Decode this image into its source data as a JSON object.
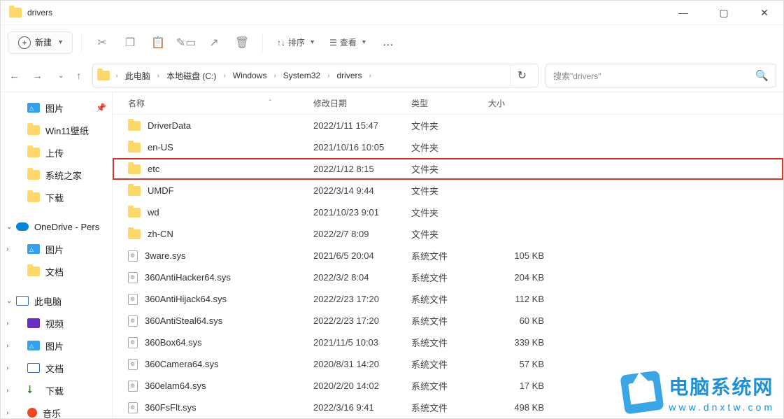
{
  "title": "drivers",
  "toolbar": {
    "new_label": "新建",
    "sort_label": "排序",
    "view_label": "查看"
  },
  "breadcrumb": [
    "此电脑",
    "本地磁盘 (C:)",
    "Windows",
    "System32",
    "drivers"
  ],
  "search": {
    "placeholder": "搜索\"drivers\""
  },
  "columns": {
    "name": "名称",
    "modified": "修改日期",
    "type": "类型",
    "size": "大小"
  },
  "sidebar": [
    {
      "label": "图片",
      "icon": "ico-pic",
      "pin": true,
      "indent": 1
    },
    {
      "label": "Win11壁纸",
      "icon": "ico-folder",
      "indent": 1
    },
    {
      "label": "上传",
      "icon": "ico-folder",
      "indent": 1
    },
    {
      "label": "系统之家",
      "icon": "ico-folder",
      "indent": 1
    },
    {
      "label": "下载",
      "icon": "ico-folder",
      "indent": 1
    },
    {
      "label": "OneDrive - Pers",
      "icon": "ico-onedrive",
      "expander": "⌄",
      "indent": 0,
      "gap": true
    },
    {
      "label": "图片",
      "icon": "ico-pic",
      "expander": "›",
      "indent": 1
    },
    {
      "label": "文档",
      "icon": "ico-folder",
      "indent": 1
    },
    {
      "label": "此电脑",
      "icon": "ico-monitor",
      "expander": "⌄",
      "indent": 0,
      "gap": true
    },
    {
      "label": "视频",
      "icon": "ico-video",
      "expander": "›",
      "indent": 1
    },
    {
      "label": "图片",
      "icon": "ico-pic",
      "expander": "›",
      "indent": 1
    },
    {
      "label": "文档",
      "icon": "ico-doc",
      "expander": "›",
      "indent": 1
    },
    {
      "label": "下载",
      "icon": "ico-dl",
      "expander": "›",
      "indent": 1,
      "dl": true
    },
    {
      "label": "音乐",
      "icon": "ico-music",
      "expander": "›",
      "indent": 1
    }
  ],
  "rows": [
    {
      "name": "DriverData",
      "mod": "2022/1/11 15:47",
      "type": "文件夹",
      "size": "",
      "folder": true
    },
    {
      "name": "en-US",
      "mod": "2021/10/16 10:05",
      "type": "文件夹",
      "size": "",
      "folder": true
    },
    {
      "name": "etc",
      "mod": "2022/1/12 8:15",
      "type": "文件夹",
      "size": "",
      "folder": true,
      "highlight": true
    },
    {
      "name": "UMDF",
      "mod": "2022/3/14 9:44",
      "type": "文件夹",
      "size": "",
      "folder": true
    },
    {
      "name": "wd",
      "mod": "2021/10/23 9:01",
      "type": "文件夹",
      "size": "",
      "folder": true
    },
    {
      "name": "zh-CN",
      "mod": "2022/2/7 8:09",
      "type": "文件夹",
      "size": "",
      "folder": true
    },
    {
      "name": "3ware.sys",
      "mod": "2021/6/5 20:04",
      "type": "系统文件",
      "size": "105 KB"
    },
    {
      "name": "360AntiHacker64.sys",
      "mod": "2022/3/2 8:04",
      "type": "系统文件",
      "size": "204 KB"
    },
    {
      "name": "360AntiHijack64.sys",
      "mod": "2022/2/23 17:20",
      "type": "系统文件",
      "size": "112 KB"
    },
    {
      "name": "360AntiSteal64.sys",
      "mod": "2022/2/23 17:20",
      "type": "系统文件",
      "size": "60 KB"
    },
    {
      "name": "360Box64.sys",
      "mod": "2021/11/5 10:03",
      "type": "系统文件",
      "size": "339 KB"
    },
    {
      "name": "360Camera64.sys",
      "mod": "2020/8/31 14:20",
      "type": "系统文件",
      "size": "57 KB"
    },
    {
      "name": "360elam64.sys",
      "mod": "2020/2/20 14:02",
      "type": "系统文件",
      "size": "17 KB"
    },
    {
      "name": "360FsFlt.sys",
      "mod": "2022/3/16 9:41",
      "type": "系统文件",
      "size": "498 KB"
    }
  ],
  "overlay": {
    "title": "电脑系统网",
    "url": "www.dnxtw.com"
  }
}
